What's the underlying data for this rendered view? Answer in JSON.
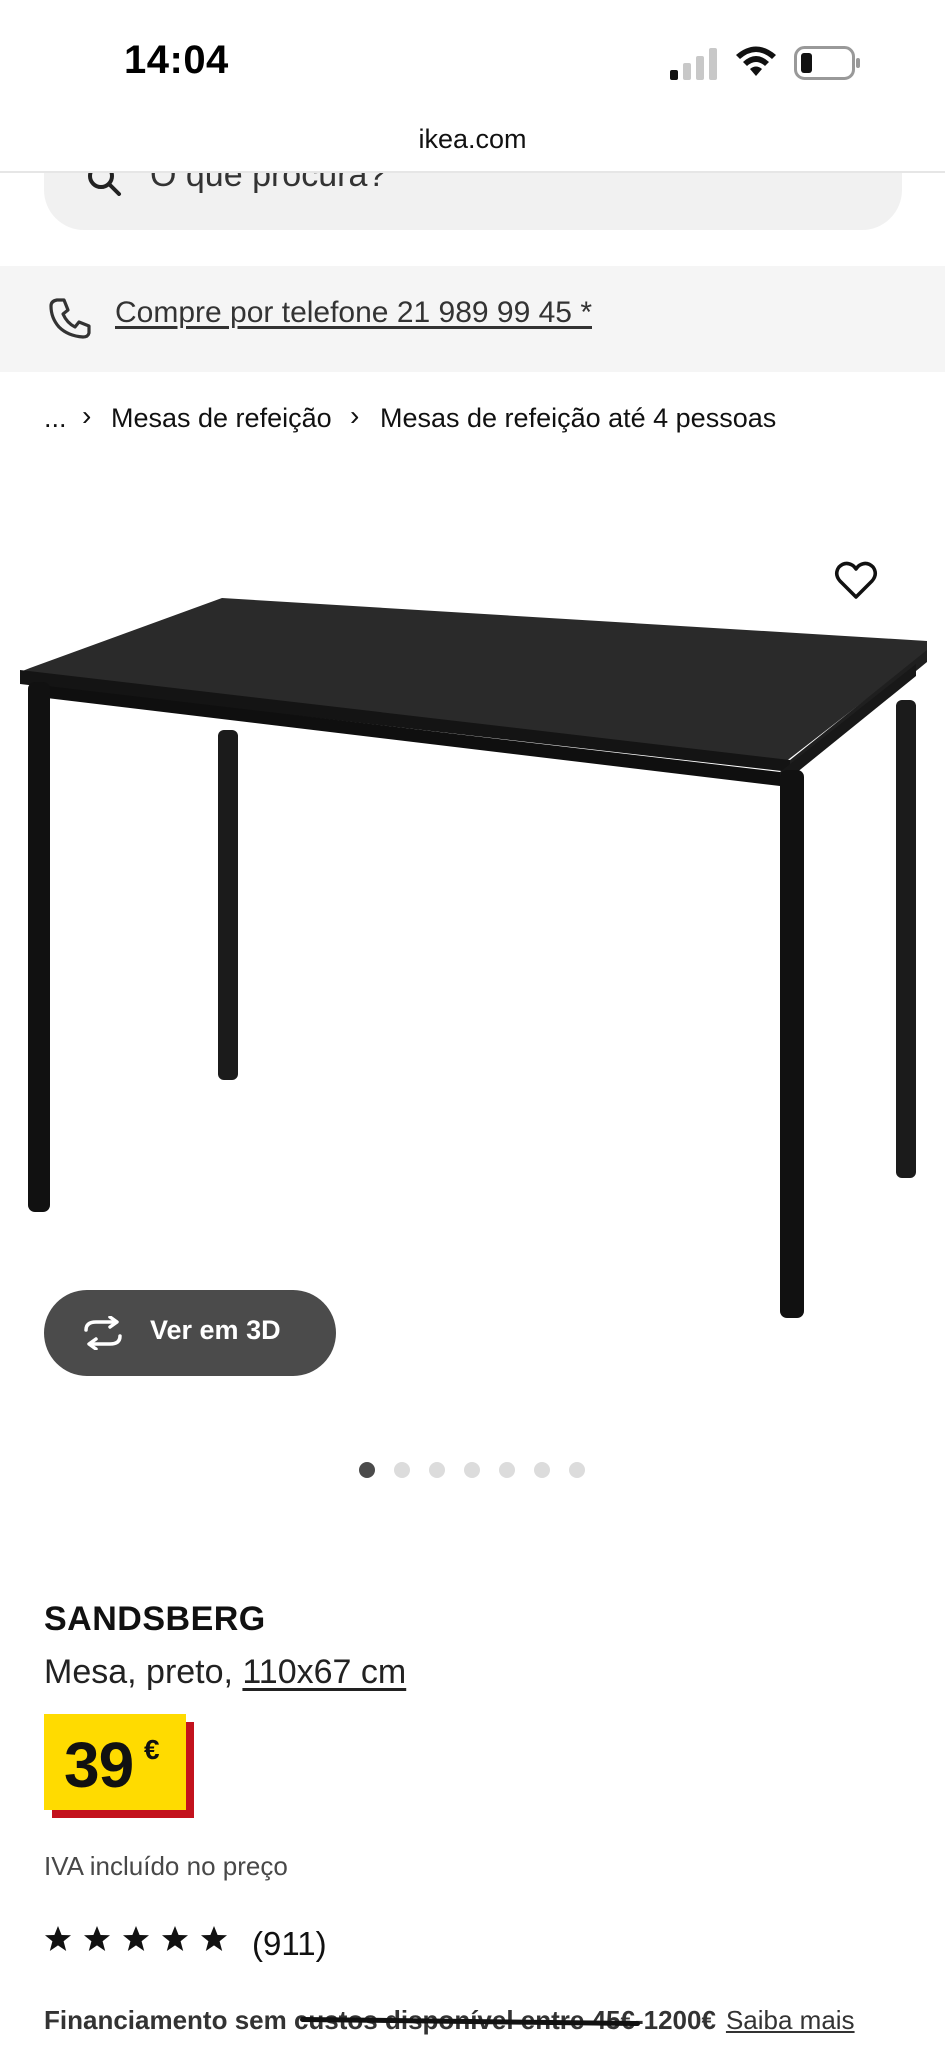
{
  "status_bar": {
    "time": "14:04",
    "icons": [
      "signal-icon",
      "wifi-icon",
      "battery-icon"
    ]
  },
  "browser": {
    "url": "ikea.com"
  },
  "search": {
    "placeholder": "O que procura?"
  },
  "banner": {
    "phone_text": "Compre por telefone 21 989 99 45 *"
  },
  "breadcrumb": {
    "items": [
      "...",
      "Mesas de refeição",
      "Mesas de refeição até 4 pessoas"
    ]
  },
  "product": {
    "view3d_label": "Ver em 3D",
    "carousel_count": 7,
    "carousel_active_index": 0,
    "name": "SANDSBERG",
    "description": "Mesa, preto, ",
    "size": "110x67 cm",
    "price": "39",
    "currency": "€",
    "vat_note": "IVA incluído no preço",
    "rating_stars": 5,
    "review_count": "(911)",
    "financing_text": "Financiamento sem custos disponível entre 45€-1200€",
    "financing_link": "Saiba mais"
  },
  "colors": {
    "price_bg": "#ffdb00",
    "price_shadow": "#c3121d",
    "dark_button": "#4b4b4b",
    "banner_bg": "#f5f5f5"
  }
}
